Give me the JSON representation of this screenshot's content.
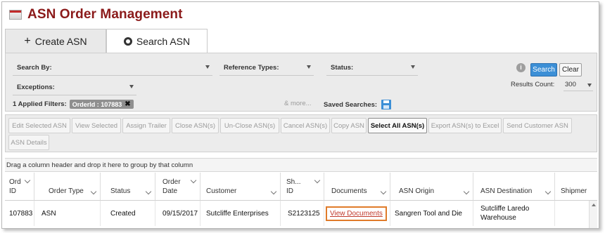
{
  "app": {
    "title": "ASN Order Management"
  },
  "tabs": [
    {
      "label": "Create ASN",
      "icon": "plus-icon"
    },
    {
      "label": "Search ASN",
      "icon": "radio-icon"
    }
  ],
  "search": {
    "search_by": "Search By:",
    "reference_types": "Reference Types:",
    "status": "Status:",
    "exceptions": "Exceptions:",
    "search_button": "Search",
    "clear_button": "Clear",
    "results_count_label": "Results Count:",
    "results_count_value": "300",
    "applied_filters_label": "1 Applied Filters:",
    "applied_filter_chip": "OrderId : 107883",
    "more_link": "& more...",
    "saved_searches_label": "Saved Searches:"
  },
  "toolbar": {
    "buttons": [
      "Edit Selected ASN",
      "View Selected",
      "Assign Trailer",
      "Close ASN(s)",
      "Un-Close ASN(s)",
      "Cancel ASN(s)",
      "Copy ASN",
      "Select All ASN(s)",
      "Export ASN(s) to Excel",
      "Send Customer ASN",
      "ASN Details"
    ]
  },
  "grid": {
    "group_hint": "Drag a column header and drop it here to group by that column",
    "columns": [
      "Ord ID",
      "Order Type",
      "Status",
      "Order Date",
      "Customer",
      "Sh... ID",
      "Documents",
      "ASN Origin",
      "ASN Destination",
      "Shipmer"
    ],
    "rows": [
      {
        "ord_id": "107883",
        "order_type": "ASN",
        "status": "Created",
        "order_date": "09/15/2017",
        "customer": "Sutcliffe Enterprises",
        "ship_id": "S2123125",
        "documents": "View Documents",
        "asn_origin": "Sangren Tool and Die",
        "asn_destination": "Sutcliffe Laredo Warehouse",
        "shipment": ""
      }
    ]
  }
}
